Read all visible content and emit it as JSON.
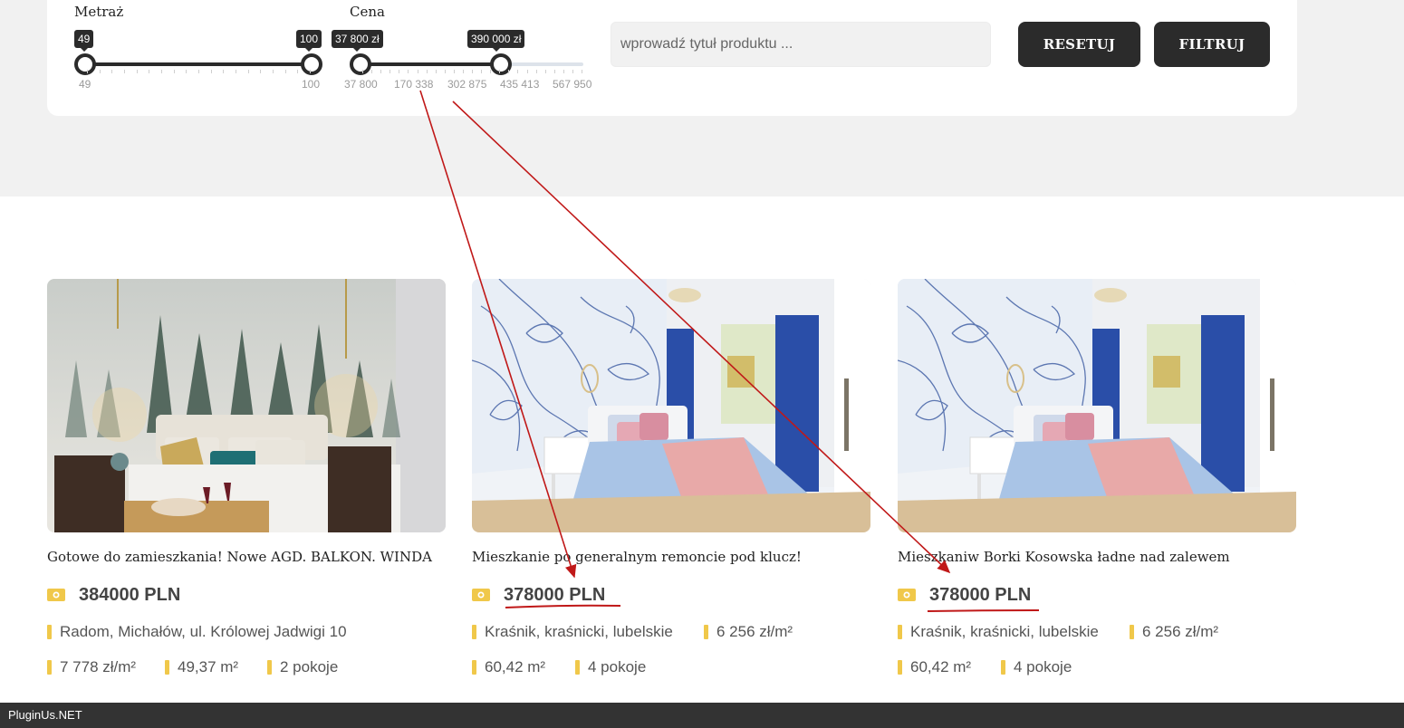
{
  "filters": {
    "area": {
      "label": "Metraż",
      "min_value": "49",
      "max_value": "100",
      "ticks": [
        "49",
        "100"
      ]
    },
    "price": {
      "label": "Cena",
      "min_value": "37 800 zł",
      "max_value": "390 000 zł",
      "ticks": [
        "37 800",
        "170 338",
        "302 875",
        "435 413",
        "567 950"
      ]
    },
    "search": {
      "placeholder": "wprowadź tytuł produktu ..."
    },
    "reset_label": "RESETUJ",
    "filter_label": "FILTRUJ"
  },
  "listings": [
    {
      "title": "Gotowe do zamieszkania! Nowe AGD. BALKON. WINDA",
      "price": "384000 PLN",
      "location": "Radom, Michałów, ul. Królowej Jadwigi 10",
      "price_per_m2": "7 778 zł/m²",
      "area": "49,37 m²",
      "rooms": "2 pokoje",
      "image": "bedroom-forest-mural"
    },
    {
      "title": "Mieszkanie po generalnym remoncie pod klucz!",
      "price": "378000 PLN",
      "location": "Kraśnik, kraśnicki, lubelskie",
      "price_per_m2": "6 256 zł/m²",
      "area": "60,42 m²",
      "rooms": "4 pokoje",
      "image": "bedroom-blue-floral-mural"
    },
    {
      "title": "Mieszkaniw Borki Kosowska ładne nad zalewem",
      "price": "378000 PLN",
      "location": "Kraśnik, kraśnicki, lubelskie",
      "price_per_m2": "6 256 zł/m²",
      "area": "60,42 m²",
      "rooms": "4 pokoje",
      "image": "bedroom-blue-floral-mural"
    }
  ],
  "icons": {
    "price": "banknote-icon",
    "info": "yellow-bar-icon"
  },
  "colors": {
    "accent": "#f0c84a",
    "dark": "#2b2b2b",
    "annotation": "#c01818"
  },
  "footer": {
    "text": "PluginUs.NET"
  }
}
